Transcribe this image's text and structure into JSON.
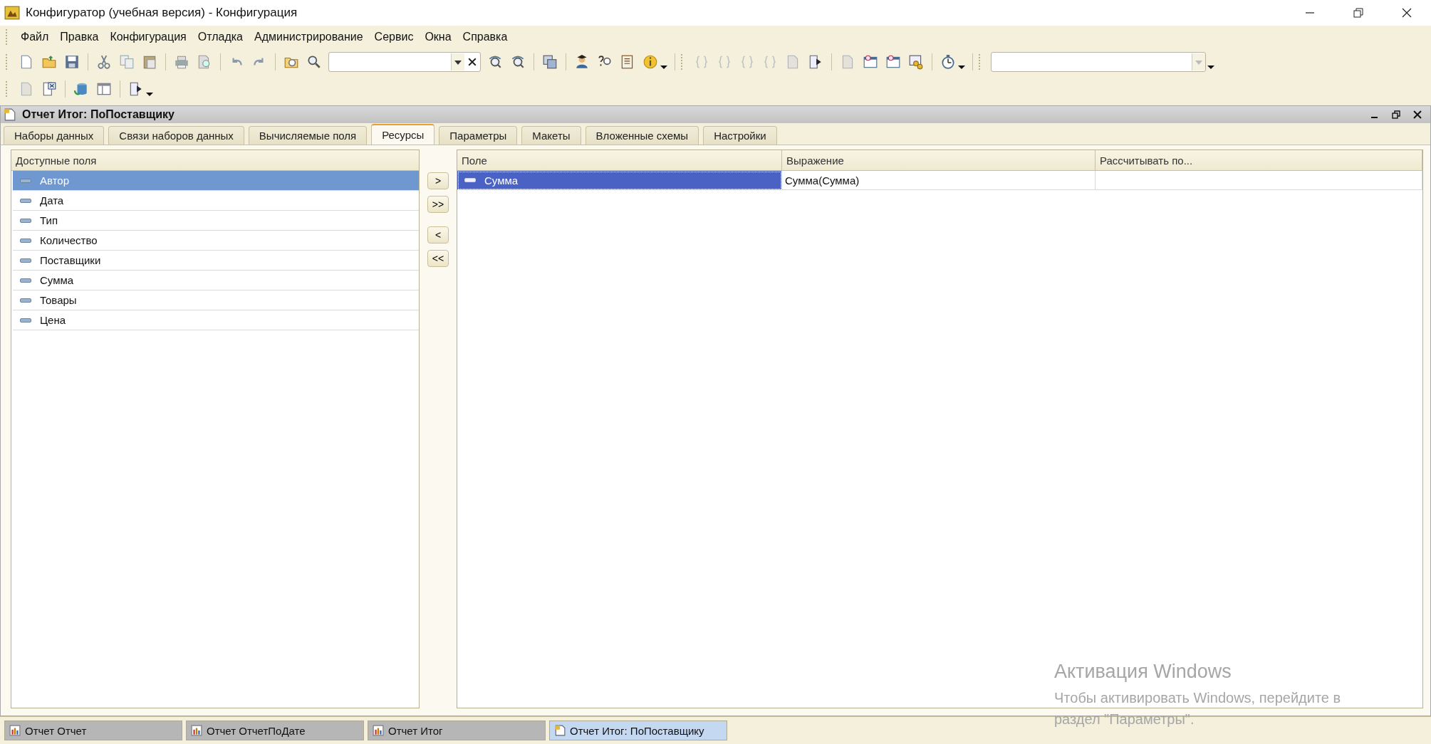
{
  "window": {
    "title": "Конфигуратор (учебная версия) - Конфигурация"
  },
  "menu": [
    "Файл",
    "Правка",
    "Конфигурация",
    "Отладка",
    "Администрирование",
    "Сервис",
    "Окна",
    "Справка"
  ],
  "document": {
    "title": "Отчет Итог: ПоПоставщику"
  },
  "tabs": [
    {
      "label": "Наборы данных",
      "selected": false
    },
    {
      "label": "Связи наборов данных",
      "selected": false
    },
    {
      "label": "Вычисляемые поля",
      "selected": false
    },
    {
      "label": "Ресурсы",
      "selected": true
    },
    {
      "label": "Параметры",
      "selected": false
    },
    {
      "label": "Макеты",
      "selected": false
    },
    {
      "label": "Вложенные схемы",
      "selected": false
    },
    {
      "label": "Настройки",
      "selected": false
    }
  ],
  "available_fields": {
    "header": "Доступные поля",
    "items": [
      {
        "label": "Автор",
        "selected": true
      },
      {
        "label": "Дата",
        "selected": false
      },
      {
        "label": "Тип",
        "selected": false
      },
      {
        "label": "Количество",
        "selected": false
      },
      {
        "label": "Поставщики",
        "selected": false
      },
      {
        "label": "Сумма",
        "selected": false
      },
      {
        "label": "Товары",
        "selected": false
      },
      {
        "label": "Цена",
        "selected": false
      }
    ]
  },
  "move_buttons": [
    ">",
    ">>",
    "<",
    "<<"
  ],
  "resources": {
    "columns": [
      "Поле",
      "Выражение",
      "Рассчитывать по..."
    ],
    "rows": [
      {
        "field": "Сумма",
        "expression": "Сумма(Сумма)",
        "selected": true
      }
    ]
  },
  "taskbar": [
    {
      "label": "Отчет Отчет",
      "selected": false
    },
    {
      "label": "Отчет ОтчетПоДате",
      "selected": false
    },
    {
      "label": "Отчет Итог",
      "selected": false
    },
    {
      "label": "Отчет Итог: ПоПоставщику",
      "selected": true
    }
  ],
  "activation_notice": {
    "title": "Активация Windows",
    "lines": [
      "Чтобы активировать Windows, перейдите в",
      "раздел \"Параметры\"."
    ]
  }
}
